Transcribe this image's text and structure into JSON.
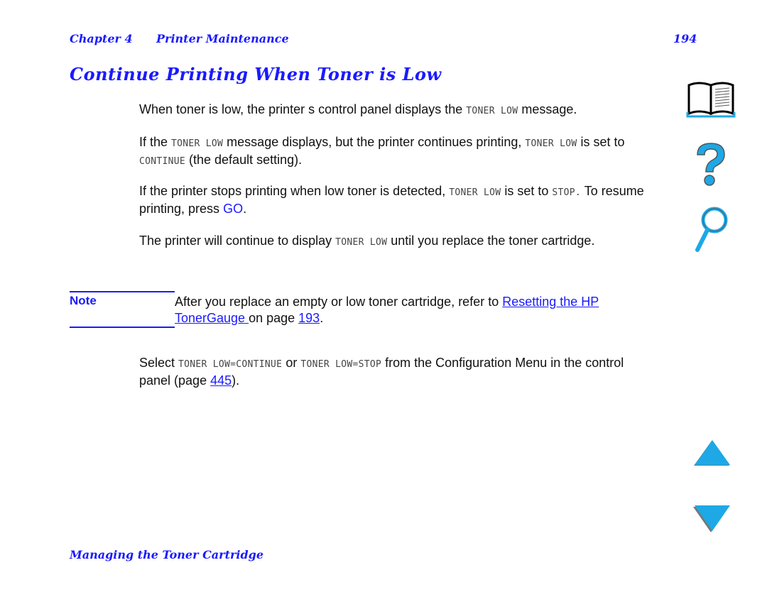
{
  "header": {
    "chapter": "Chapter 4",
    "chapter_title": "Printer Maintenance",
    "page_number": "194"
  },
  "title": "Continue Printing When Toner is Low",
  "paragraphs": {
    "p1": {
      "a": "When toner is low, the printer s control panel displays the ",
      "lcd1": "TONER LOW",
      "b": " message."
    },
    "p2": {
      "a": "If the ",
      "lcd1": "TONER LOW",
      "b": " message displays, but the printer continues printing, ",
      "lcd2": "TONER LOW",
      "c": " is set to ",
      "lcd3": "CONTINUE",
      "d": " (the default setting)."
    },
    "p3": {
      "a": "If the printer stops printing when low toner is detected, ",
      "lcd1": "TONER LOW",
      "b": " is set to ",
      "lcd2": "STOP.",
      "c": " To resume printing, press ",
      "go": "GO",
      "d": "."
    },
    "p4": {
      "a": "The printer will continue to display ",
      "lcd1": "TONER LOW",
      "b": " until you replace the toner cartridge."
    },
    "p5": {
      "a": "Select ",
      "lcd1": "TONER LOW=CONTINUE",
      "b": " or ",
      "lcd2": "TONER LOW=STOP",
      "c": " from the Configuration Menu in the control panel (page ",
      "link": "445",
      "d": ")."
    }
  },
  "note": {
    "label": "Note",
    "text_a": "After you replace an empty or low toner cartridge, refer to ",
    "link_text": " Resetting the HP TonerGauge ",
    "text_b": " on page ",
    "page_link": "193",
    "text_c": "."
  },
  "footer": "Managing the Toner Cartridge",
  "nav_icons": [
    "book-icon",
    "help-icon",
    "search-icon",
    "previous-page-icon",
    "next-page-icon"
  ],
  "colors": {
    "accent": "#1a1aff",
    "icon": "#1ea8e6"
  }
}
